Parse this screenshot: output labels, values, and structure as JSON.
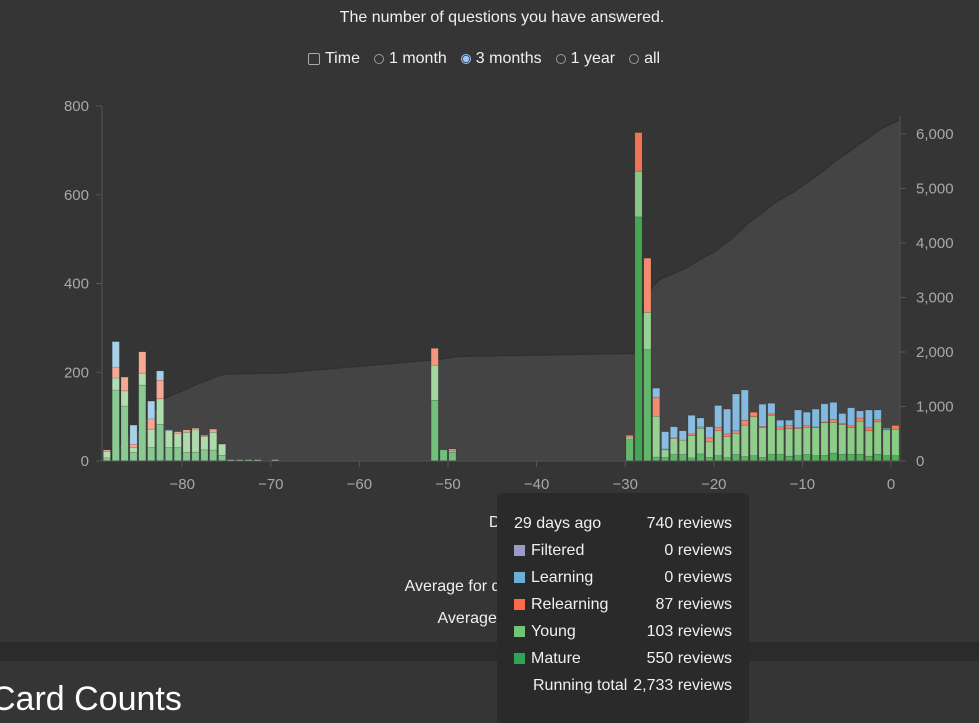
{
  "subtitle": "The number of questions you have answered.",
  "controls": {
    "time_label": "Time",
    "time_checked": false,
    "ranges": [
      {
        "label": "1 month",
        "selected": false
      },
      {
        "label": "3 months",
        "selected": true
      },
      {
        "label": "1 year",
        "selected": false
      },
      {
        "label": "all",
        "selected": false
      }
    ]
  },
  "stats_labels": [
    "Days stud",
    "T",
    "Average for days stud",
    "Average over per"
  ],
  "tooltip": {
    "title": "29 days ago",
    "title_value": "740 reviews",
    "rows": [
      {
        "label": "Filtered",
        "value": "0 reviews",
        "color": "#9e9ac8"
      },
      {
        "label": "Learning",
        "value": "0 reviews",
        "color": "#6baed6"
      },
      {
        "label": "Relearning",
        "value": "87 reviews",
        "color": "#fb6a4a"
      },
      {
        "label": "Young",
        "value": "103 reviews",
        "color": "#74c476"
      },
      {
        "label": "Mature",
        "value": "550 reviews",
        "color": "#31a354"
      }
    ],
    "running_label": "Running total",
    "running_value": "2,733 reviews"
  },
  "next_section_heading": "Card Counts",
  "chart_data": {
    "type": "bar",
    "stacked": true,
    "title": "The number of questions you have answered.",
    "xlabel": "",
    "ylabel": "",
    "xlim": [
      -89,
      0
    ],
    "ylim": [
      0,
      800
    ],
    "y2lim": [
      0,
      6500
    ],
    "x_ticks": [
      "−80",
      "−70",
      "−60",
      "−50",
      "−40",
      "−30",
      "−20",
      "−10",
      "0"
    ],
    "x_tick_values": [
      -80,
      -70,
      -60,
      -50,
      -40,
      -30,
      -20,
      -10,
      0
    ],
    "y_ticks": [
      "0",
      "200",
      "400",
      "600",
      "800"
    ],
    "y_tick_values": [
      0,
      200,
      400,
      600,
      800
    ],
    "y2_ticks": [
      "0",
      "1,000",
      "2,000",
      "3,000",
      "4,000",
      "5,000",
      "6,000"
    ],
    "y2_tick_values": [
      0,
      1000,
      2000,
      3000,
      4000,
      5000,
      6000
    ],
    "hovered_day": -29,
    "series_names": [
      "Mature",
      "Young",
      "Relearning",
      "Learning"
    ],
    "colors": {
      "Mature": "#4fae5a",
      "Young": "#8acb86",
      "Relearning": "#f07d5e",
      "Learning": "#7db6de",
      "cumulative": "#444444"
    },
    "days": [
      -89,
      -88,
      -87,
      -86,
      -85,
      -84,
      -83,
      -82,
      -81,
      -80,
      -79,
      -78,
      -77,
      -76,
      -75,
      -74,
      -73,
      -72,
      -70,
      -52,
      -51,
      -50,
      -30,
      -29,
      -28,
      -27,
      -26,
      -25,
      -24,
      -23,
      -22,
      -21,
      -20,
      -19,
      -18,
      -17,
      -16,
      -15,
      -14,
      -13,
      -12,
      -11,
      -10,
      -9,
      -8,
      -7,
      -6,
      -5,
      -4,
      -3,
      -2,
      -1,
      0
    ],
    "series": [
      {
        "name": "Mature",
        "values": [
          7,
          160,
          124,
          19,
          171,
          31,
          83,
          30,
          30,
          20,
          20,
          25,
          25,
          13,
          0,
          0,
          0,
          0,
          0,
          137,
          25,
          20,
          48,
          550,
          251,
          9,
          8,
          15,
          14,
          7,
          16,
          8,
          12,
          8,
          15,
          10,
          12,
          8,
          15,
          15,
          11,
          12,
          15,
          12,
          12,
          18,
          15,
          15,
          15,
          11,
          15,
          12,
          12
        ]
      },
      {
        "name": "Young",
        "values": [
          15,
          27,
          34,
          12,
          27,
          41,
          57,
          38,
          32,
          45,
          50,
          30,
          40,
          25,
          3,
          3,
          3,
          3,
          3,
          79,
          0,
          3,
          6,
          103,
          84,
          92,
          17,
          36,
          33,
          50,
          58,
          35,
          56,
          47,
          47,
          71,
          88,
          67,
          88,
          56,
          62,
          61,
          61,
          63,
          74,
          69,
          67,
          60,
          74,
          57,
          73,
          59,
          59
        ]
      },
      {
        "name": "Relearning",
        "values": [
          3,
          23,
          31,
          7,
          48,
          23,
          42,
          0,
          4,
          5,
          4,
          3,
          7,
          0,
          0,
          0,
          0,
          0,
          0,
          38,
          0,
          4,
          4,
          87,
          122,
          43,
          2,
          1,
          0,
          4,
          3,
          9,
          7,
          6,
          6,
          11,
          10,
          3,
          3,
          6,
          7,
          2,
          4,
          2,
          2,
          6,
          2,
          5,
          8,
          7,
          5,
          1,
          9
        ]
      },
      {
        "name": "Learning",
        "values": [
          0,
          59,
          0,
          43,
          0,
          40,
          21,
          2,
          0,
          0,
          0,
          0,
          0,
          0,
          0,
          0,
          0,
          0,
          0,
          0,
          0,
          0,
          0,
          0,
          0,
          20,
          39,
          25,
          21,
          42,
          20,
          25,
          50,
          56,
          83,
          68,
          0,
          50,
          24,
          15,
          12,
          40,
          30,
          40,
          41,
          39,
          23,
          40,
          16,
          40,
          22,
          2,
          0
        ]
      }
    ],
    "cumulative_series": "Running total",
    "grid": false,
    "legend": "none"
  }
}
